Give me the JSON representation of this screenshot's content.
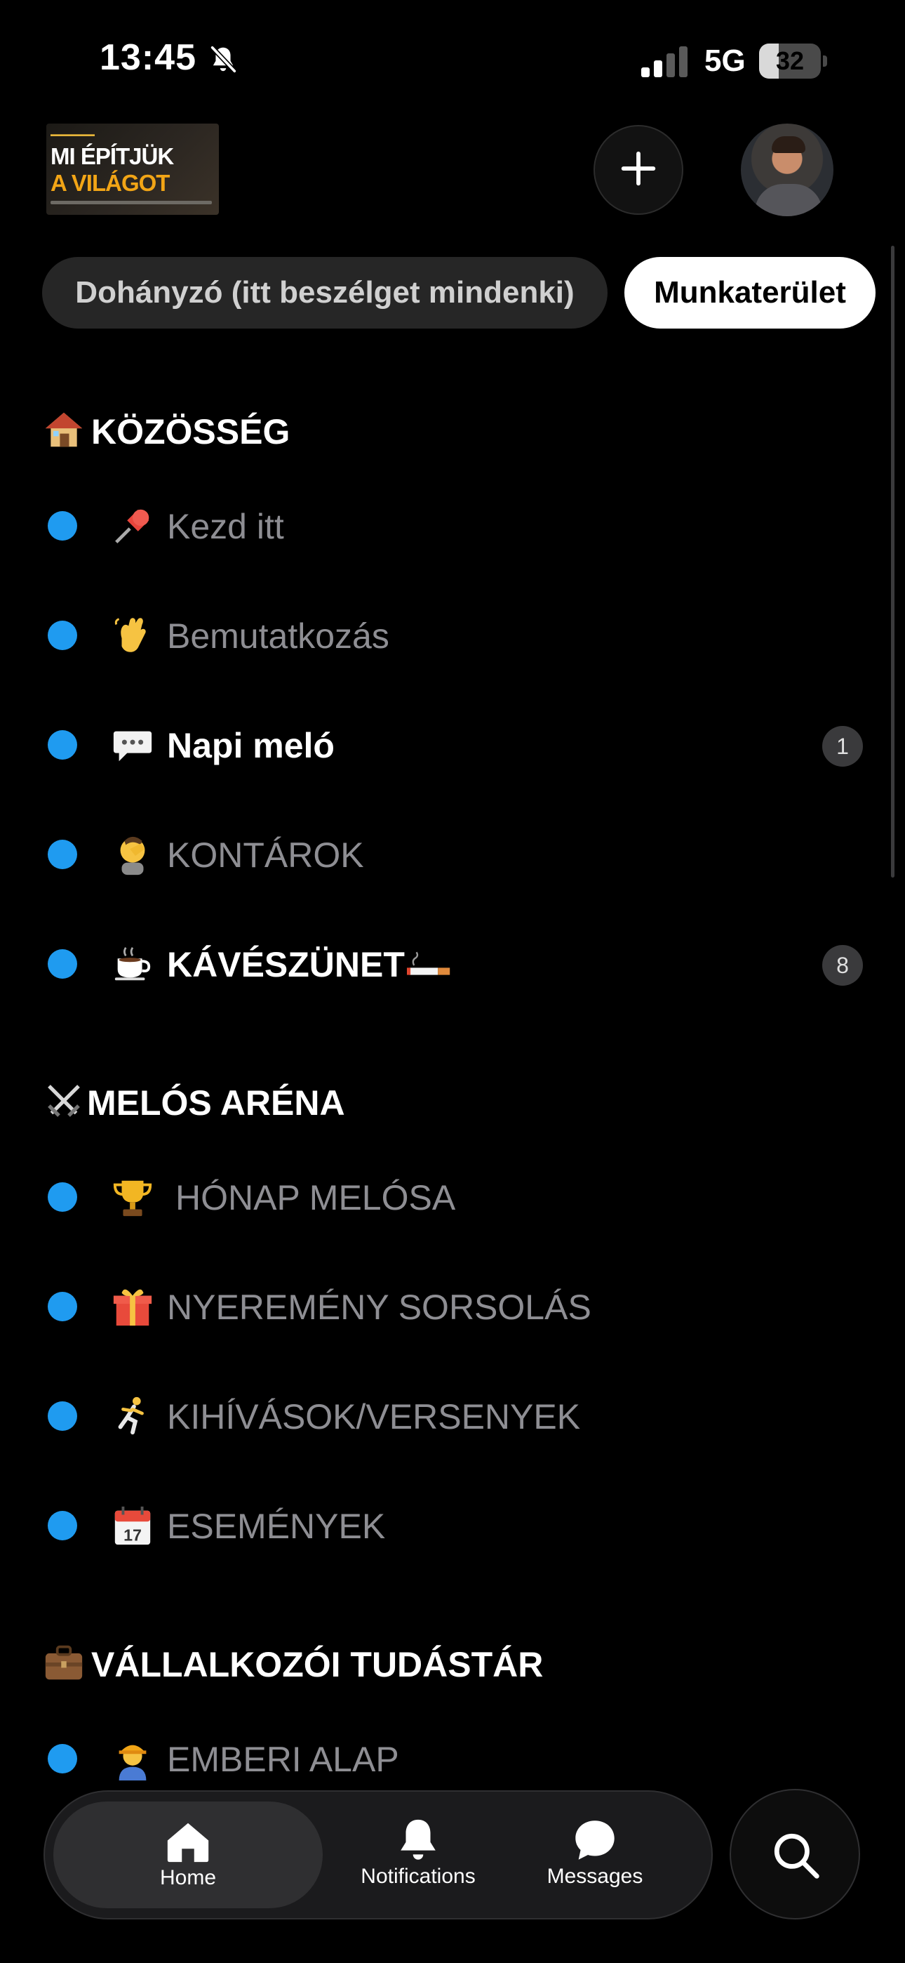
{
  "status_bar": {
    "time": "13:45",
    "network": "5G",
    "battery": "32",
    "battery_level": 0.32,
    "silent_icon": "bell-slash-icon"
  },
  "header": {
    "logo": {
      "line1": "MI ÉPÍTJÜK",
      "line2": "A VILÁGOT"
    },
    "add_icon": "plus-icon",
    "avatar_icon": "profile-avatar"
  },
  "tabs": [
    {
      "label": "Dohányzó (itt beszélget mindenki)",
      "active": false
    },
    {
      "label": "Munkaterület",
      "active": true
    }
  ],
  "sections": [
    {
      "title": "KÖZÖSSÉG",
      "icon": "house-icon",
      "channels": [
        {
          "label": "Kezd itt",
          "icon": "pushpin-icon",
          "unread": false,
          "badge": ""
        },
        {
          "label": "Bemutatkozás",
          "icon": "waving-hand-icon",
          "unread": false,
          "badge": ""
        },
        {
          "label": "Napi meló",
          "icon": "speech-bubble-icon",
          "unread": true,
          "badge": "1"
        },
        {
          "label": "KONTÁROK",
          "icon": "facepalm-icon",
          "unread": false,
          "badge": ""
        },
        {
          "label": "KÁVÉSZÜNET",
          "icon": "coffee-icon",
          "suffix_icon": "cigarette-icon",
          "unread": true,
          "badge": "8"
        }
      ]
    },
    {
      "title": "MELÓS ARÉNA",
      "icon": "crossed-swords-icon",
      "channels": [
        {
          "label": "HÓNAP MELÓSA",
          "icon": "trophy-icon",
          "unread": false,
          "badge": ""
        },
        {
          "label": "NYEREMÉNY SORSOLÁS",
          "icon": "gift-icon",
          "unread": false,
          "badge": ""
        },
        {
          "label": "KIHÍVÁSOK/VERSENYEK",
          "icon": "runner-icon",
          "unread": false,
          "badge": ""
        },
        {
          "label": "ESEMÉNYEK",
          "icon": "calendar-icon",
          "unread": false,
          "badge": ""
        }
      ]
    },
    {
      "title": "VÁLLALKOZÓI TUDÁSTÁR",
      "icon": "briefcase-icon",
      "channels": [
        {
          "label": "EMBERI ALAP",
          "icon": "construction-worker-icon",
          "unread": false,
          "badge": ""
        }
      ]
    }
  ],
  "bottom_nav": {
    "items": [
      {
        "label": "Home",
        "icon": "home-icon",
        "active": true
      },
      {
        "label": "Notifications",
        "icon": "bell-icon",
        "active": false
      },
      {
        "label": "Messages",
        "icon": "chat-bubble-icon",
        "active": false
      }
    ],
    "search_icon": "search-icon"
  },
  "colors": {
    "background": "#000000",
    "unread_dot": "#1f9bf0",
    "muted_text": "#8e8e93",
    "badge_bg": "#3a3a3c"
  }
}
